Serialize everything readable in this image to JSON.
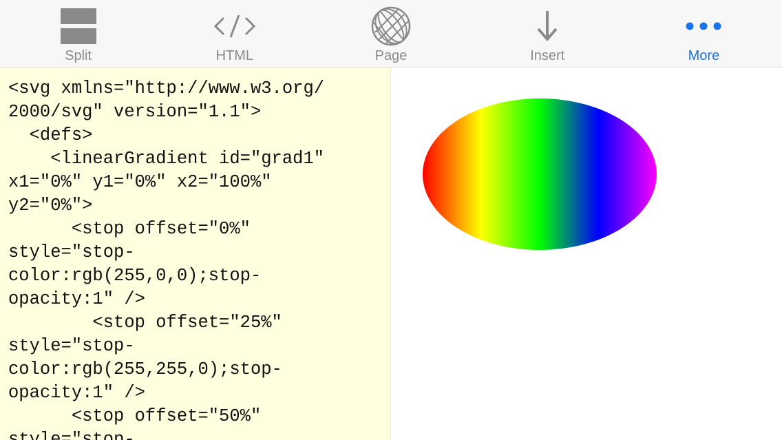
{
  "toolbar": {
    "items": [
      {
        "label": "Split",
        "icon": "split-icon"
      },
      {
        "label": "HTML",
        "icon": "code-icon"
      },
      {
        "label": "Page",
        "icon": "globe-icon"
      },
      {
        "label": "Insert",
        "icon": "arrow-down-icon"
      },
      {
        "label": "More",
        "icon": "more-icon"
      }
    ],
    "active_index": 4,
    "active_color": "#1a73e8",
    "inactive_color": "#8a8a8a"
  },
  "editor": {
    "background": "#ffffe0",
    "lines": [
      "<svg xmlns=\"http://www.w3.org/",
      "2000/svg\" version=\"1.1\">",
      "  <defs>",
      "    <linearGradient id=\"grad1\"",
      "x1=\"0%\" y1=\"0%\" x2=\"100%\"",
      "y2=\"0%\">",
      "      <stop offset=\"0%\"",
      "style=\"stop-",
      "color:rgb(255,0,0);stop-",
      "opacity:1\" />",
      "        <stop offset=\"25%\"",
      "style=\"stop-",
      "color:rgb(255,255,0);stop-",
      "opacity:1\" />",
      "      <stop offset=\"50%\"",
      "style=\"stop-"
    ]
  },
  "preview": {
    "gradient_stops": [
      {
        "offset": 0,
        "color": "#ff0000"
      },
      {
        "offset": 0.25,
        "color": "#ffff00"
      },
      {
        "offset": 0.5,
        "color": "#00ff00"
      },
      {
        "offset": 0.75,
        "color": "#0000ff"
      },
      {
        "offset": 1,
        "color": "#ff00ff"
      }
    ]
  }
}
